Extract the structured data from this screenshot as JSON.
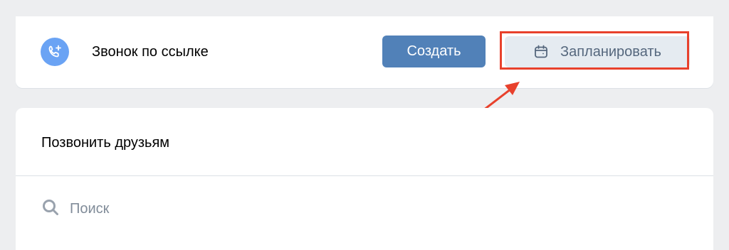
{
  "call_by_link": {
    "title": "Звонок по ссылке",
    "create_label": "Создать",
    "schedule_label": "Запланировать"
  },
  "call_friends": {
    "title": "Позвонить друзьям",
    "search_placeholder": "Поиск"
  },
  "colors": {
    "page_background": "#edeef0",
    "card_background": "#ffffff",
    "primary_button": "#5181b8",
    "secondary_button": "#e5ebf1",
    "secondary_text": "#55677d",
    "avatar": "#6aa3f4",
    "placeholder": "#818c99",
    "annotation": "#e8412c"
  },
  "icons": {
    "avatar": "phone-plus-icon",
    "schedule": "calendar-icon",
    "search": "search-icon"
  }
}
